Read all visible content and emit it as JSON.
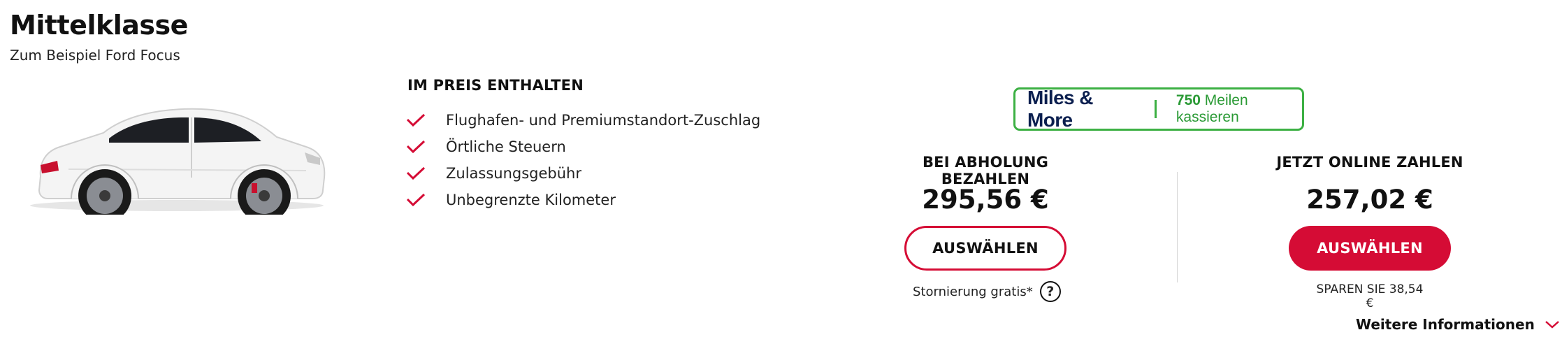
{
  "vehicle": {
    "class_title": "Mittelklasse",
    "example": "Zum Beispiel Ford Focus"
  },
  "included": {
    "heading": "IM PREIS ENTHALTEN",
    "items": [
      "Flughafen- und Premiumstandort-Zuschlag",
      "Örtliche Steuern",
      "Zulassungsgebühr",
      "Unbegrenzte Kilometer"
    ],
    "icon": "checkmark-icon",
    "accent": "#d50c35"
  },
  "miles_more": {
    "logo": "Miles & More",
    "miles_value": "750",
    "miles_text": "Meilen kassieren",
    "color": "#3cb043"
  },
  "pay_at_pickup": {
    "heading": "BEI ABHOLUNG BEZAHLEN",
    "price": "295,56 €",
    "button": "AUSWÄHLEN",
    "cancellation": "Stornierung gratis*",
    "help_icon": "?"
  },
  "pay_online": {
    "heading": "JETZT ONLINE ZAHLEN",
    "price": "257,02 €",
    "button": "AUSWÄHLEN",
    "savings": "SPAREN SIE 38,54 €"
  },
  "more_info": {
    "label": "Weitere Informationen",
    "icon": "chevron-down-icon"
  },
  "colors": {
    "brand_red": "#d50c35",
    "text": "#111111"
  }
}
